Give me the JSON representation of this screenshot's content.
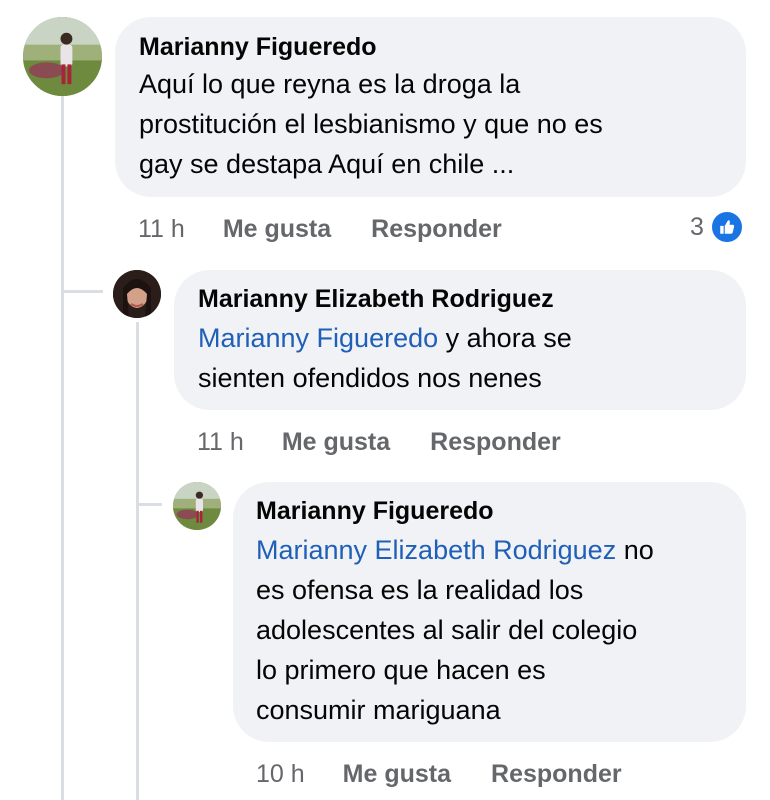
{
  "comments": [
    {
      "author": "Marianny Figueredo",
      "text_lines": [
        "Aquí lo que reyna es la droga la",
        "prostitución el lesbianismo y que no es",
        "gay se destapa Aquí en chile ..."
      ],
      "time": "11 h",
      "like_label": "Me gusta",
      "reply_label": "Responder",
      "reaction_count": "3",
      "reaction_icon": "thumbs-up-icon"
    },
    {
      "author": "Marianny Elizabeth Rodriguez",
      "mention": "Marianny Figueredo",
      "text_after_mention": " y ahora se",
      "text_lines": [
        "sienten ofendidos nos nenes"
      ],
      "time": "11 h",
      "like_label": "Me gusta",
      "reply_label": "Responder"
    },
    {
      "author": "Marianny Figueredo",
      "mention": "Marianny Elizabeth Rodriguez",
      "text_after_mention": " no",
      "text_lines": [
        "es ofensa es la realidad los",
        "adolescentes al salir del colegio",
        "lo primero que hacen es",
        "consumir mariguana"
      ],
      "time": "10 h",
      "like_label": "Me gusta",
      "reply_label": "Responder"
    }
  ],
  "colors": {
    "bubble": "#f0f2f5",
    "mention": "#1f5fb8",
    "meta": "#65676b",
    "like_badge": "#1b74e4"
  }
}
